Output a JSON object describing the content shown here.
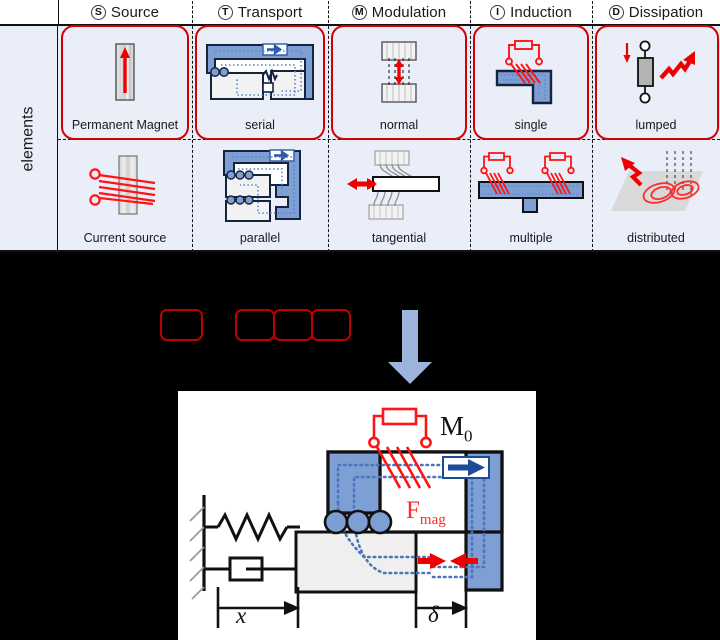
{
  "matrix": {
    "row_axis_label": "elements",
    "columns": [
      {
        "code": "S",
        "name": "Source"
      },
      {
        "code": "T",
        "name": "Transport"
      },
      {
        "code": "M",
        "name": "Modulation"
      },
      {
        "code": "I",
        "name": "Induction"
      },
      {
        "code": "D",
        "name": "Dissipation"
      }
    ],
    "rows": [
      {
        "cells": [
          {
            "label": "Permanent Magnet",
            "icon": "permanent-magnet-icon",
            "selected": true
          },
          {
            "label": "serial",
            "icon": "serial-transport-icon",
            "selected": true
          },
          {
            "label": "normal",
            "icon": "normal-modulation-icon",
            "selected": true
          },
          {
            "label": "single",
            "icon": "single-coil-icon",
            "selected": true
          },
          {
            "label": "lumped",
            "icon": "lumped-dissipation-icon",
            "selected": true
          }
        ]
      },
      {
        "cells": [
          {
            "label": "Current source",
            "icon": "current-source-icon",
            "selected": false
          },
          {
            "label": "parallel",
            "icon": "parallel-transport-icon",
            "selected": false
          },
          {
            "label": "tangential",
            "icon": "tangential-modulation-icon",
            "selected": false
          },
          {
            "label": "multiple",
            "icon": "multiple-coil-icon",
            "selected": false
          },
          {
            "label": "distributed",
            "icon": "distributed-dissipation-icon",
            "selected": false
          }
        ]
      }
    ]
  },
  "selection_band": {
    "boxes": [
      {
        "group": "single",
        "count": 1
      },
      {
        "group": "joined",
        "count": 3
      }
    ],
    "arrow": "down-arrow-icon"
  },
  "schematic": {
    "labels": {
      "mover_mass": "M",
      "mover_mass_sub": "0",
      "magnetic_force": "F",
      "magnetic_force_sub": "mag",
      "displacement": "x",
      "gap": "δ"
    },
    "icons": {
      "ground": "fixed-ground-hatching-icon",
      "spring": "spring-icon",
      "damper": "damper-icon",
      "rollers": "roller-bearing-icon",
      "coil": "coil-winding-icon",
      "flux": "magnetic-flux-path-icon",
      "motion_arrow": "motion-direction-arrow-icon",
      "force_arrows": "attraction-force-arrows-icon"
    }
  },
  "colors": {
    "highlight_red": "#d40000",
    "force_red": "#ff2b2b",
    "iron_blue": "#7d9fd4",
    "flux_blue": "#4a76bd",
    "cell_bg": "#eaeef9",
    "arrow_blue": "#9db5dd",
    "background": "#000000"
  }
}
